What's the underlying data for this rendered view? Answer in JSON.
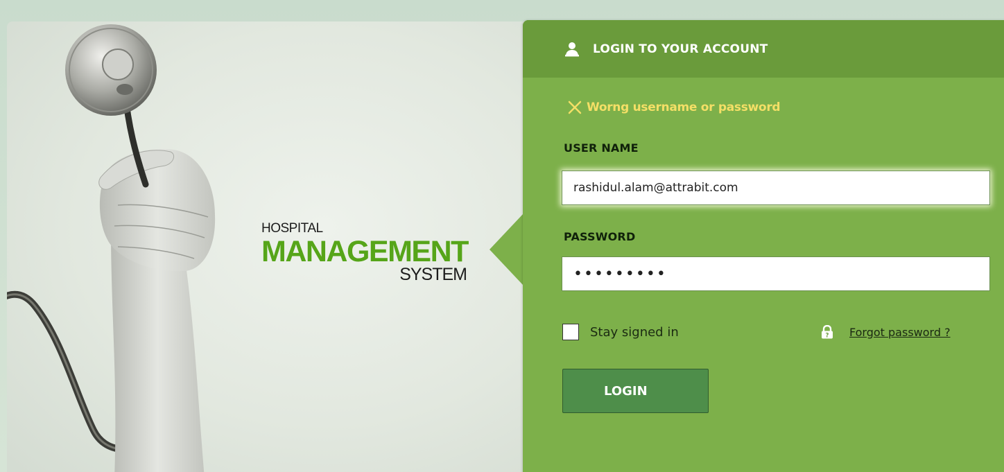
{
  "branding": {
    "line1": "HOSPITAL",
    "line2": "MANAGEMENT",
    "line3": "SYSTEM"
  },
  "login_panel": {
    "title": "LOGIN TO YOUR ACCOUNT",
    "error_message": "Worng username or password",
    "username_label": "USER NAME",
    "username_value": "rashidul.alam@attrabit.com",
    "password_label": "PASSWORD",
    "password_value": "•••••••••",
    "stay_signed_in_label": "Stay signed in",
    "stay_signed_in_checked": false,
    "forgot_password_label": "Forgot password ?",
    "login_button_label": "LOGIN"
  },
  "icons": {
    "user": "user-icon",
    "error": "close-x-icon",
    "lock": "lock-icon"
  },
  "colors": {
    "panel": "#7db04a",
    "panel_header": "#6a9b3b",
    "error_text": "#f4df66",
    "brand_green": "#56a519",
    "login_button": "#4e8e4a"
  }
}
